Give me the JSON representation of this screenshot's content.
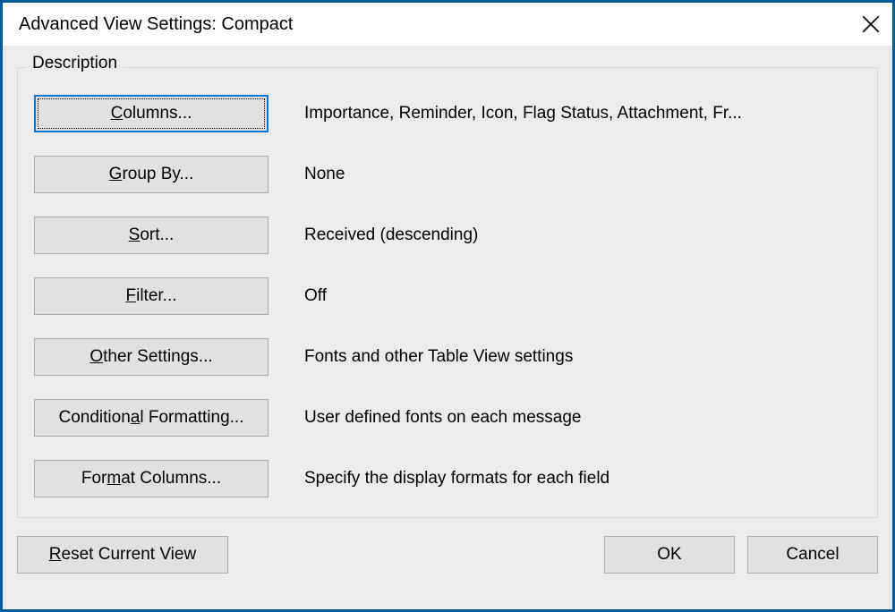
{
  "titlebar": {
    "title": "Advanced View Settings: Compact"
  },
  "fieldset": {
    "legend": "Description"
  },
  "rows": {
    "columns": {
      "pre": "",
      "accel": "C",
      "post": "olumns...",
      "desc": "Importance, Reminder, Icon, Flag Status, Attachment, Fr..."
    },
    "groupby": {
      "pre": "",
      "accel": "G",
      "post": "roup By...",
      "desc": "None"
    },
    "sort": {
      "pre": "",
      "accel": "S",
      "post": "ort...",
      "desc": "Received (descending)"
    },
    "filter": {
      "pre": "",
      "accel": "F",
      "post": "ilter...",
      "desc": "Off"
    },
    "other": {
      "pre": "",
      "accel": "O",
      "post": "ther Settings...",
      "desc": "Fonts and other Table View settings"
    },
    "conditional": {
      "pre": "Condition",
      "accel": "a",
      "post": "l Formatting...",
      "desc": "User defined fonts on each message"
    },
    "format": {
      "pre": "For",
      "accel": "m",
      "post": "at Columns...",
      "desc": "Specify the display formats for each field"
    }
  },
  "footer": {
    "reset": {
      "pre": "",
      "accel": "R",
      "post": "eset Current View"
    },
    "ok": "OK",
    "cancel": "Cancel"
  }
}
